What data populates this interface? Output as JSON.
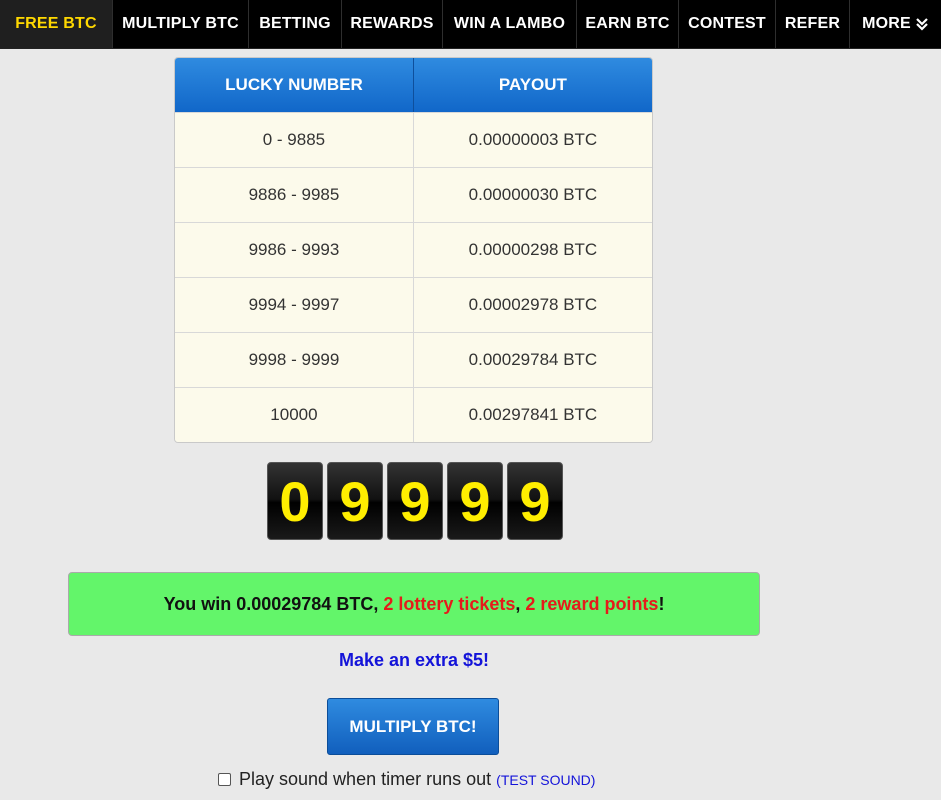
{
  "nav": {
    "items": [
      {
        "label": "FREE BTC",
        "active": true
      },
      {
        "label": "MULTIPLY BTC"
      },
      {
        "label": "BETTING"
      },
      {
        "label": "REWARDS"
      },
      {
        "label": "WIN A LAMBO"
      },
      {
        "label": "EARN BTC"
      },
      {
        "label": "CONTEST"
      },
      {
        "label": "REFER"
      },
      {
        "label": "MORE",
        "icon": "double-chevron-down-icon"
      }
    ]
  },
  "payout_table": {
    "headers": [
      "LUCKY NUMBER",
      "PAYOUT"
    ],
    "rows": [
      [
        "0 - 9885",
        "0.00000003 BTC"
      ],
      [
        "9886 - 9985",
        "0.00000030 BTC"
      ],
      [
        "9986 - 9993",
        "0.00000298 BTC"
      ],
      [
        "9994 - 9997",
        "0.00002978 BTC"
      ],
      [
        "9998 - 9999",
        "0.00029784 BTC"
      ],
      [
        "10000",
        "0.00297841 BTC"
      ]
    ]
  },
  "lucky_digits": [
    "0",
    "9",
    "9",
    "9",
    "9"
  ],
  "win": {
    "prefix": "You win 0.00029784 BTC, ",
    "tickets": "2 lottery tickets",
    "separator": ", ",
    "points": "2 reward points",
    "suffix": "!"
  },
  "extra_link": "Make an extra $5!",
  "multiply_button": "MULTIPLY BTC!",
  "sound": {
    "label": "Play sound when timer runs out",
    "open_paren": "(",
    "test_link": "TEST SOUND",
    "close_paren": ")"
  },
  "colors": {
    "nav_active": "#ffd800",
    "header_blue": "#1a74d6",
    "win_green": "#63f56a",
    "win_red": "#e51b1b",
    "link_blue": "#1414d9",
    "digit_yellow": "#ffee00"
  }
}
